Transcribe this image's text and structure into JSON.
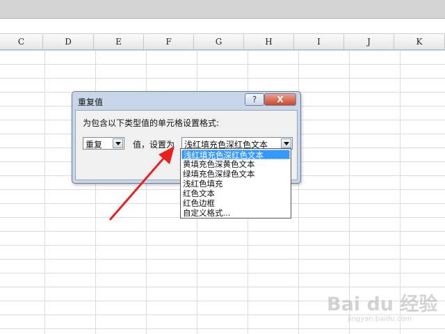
{
  "spreadsheet": {
    "columns": [
      "C",
      "D",
      "E",
      "F",
      "G",
      "H",
      "I",
      "J",
      "K"
    ]
  },
  "dialog": {
    "title": "重复值",
    "help_label": "?",
    "close_label": "X",
    "instruction": "为包含以下类型值的单元格设置格式:",
    "type_combo_value": "重复",
    "middle_label": "值，设置为",
    "format_combo_value": "浅红填充色深红色文本"
  },
  "dropdown": {
    "options": [
      "浅红填充色深红色文本",
      "黄填充色深黄色文本",
      "绿填充色深绿色文本",
      "浅红色填充",
      "红色文本",
      "红色边框",
      "自定义格式..."
    ],
    "selected_index": 0
  },
  "watermark": {
    "logo": "Bai du 经验",
    "url": "jingyan.baidu.com"
  },
  "colors": {
    "arrow": "#e8201e",
    "selection": "#3399ff",
    "dialog_frame": "#c8d6e9"
  }
}
